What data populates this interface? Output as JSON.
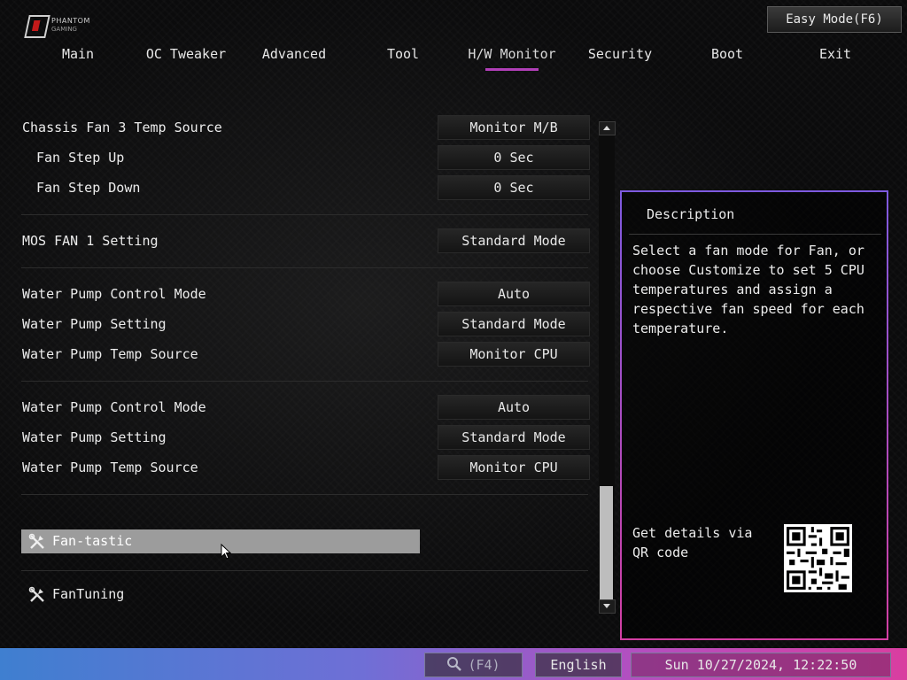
{
  "header": {
    "logo_line1": "PHANTOM",
    "logo_line2": "GAMING",
    "easy_mode": "Easy Mode(F6)"
  },
  "tabs": [
    {
      "label": "Main"
    },
    {
      "label": "OC Tweaker"
    },
    {
      "label": "Advanced"
    },
    {
      "label": "Tool"
    },
    {
      "label": "H/W Monitor",
      "active": true
    },
    {
      "label": "Security"
    },
    {
      "label": "Boot"
    },
    {
      "label": "Exit"
    }
  ],
  "settings": [
    {
      "label": "Chassis Fan 3 Temp Source",
      "value": "Monitor M/B"
    },
    {
      "label": "Fan Step Up",
      "value": "0 Sec"
    },
    {
      "label": "Fan Step Down",
      "value": "0 Sec"
    },
    {
      "label": "MOS FAN 1 Setting",
      "value": "Standard Mode"
    },
    {
      "label": "Water Pump Control Mode",
      "value": "Auto"
    },
    {
      "label": "Water Pump Setting",
      "value": "Standard Mode"
    },
    {
      "label": "Water Pump Temp Source",
      "value": "Monitor CPU"
    },
    {
      "label": "Water Pump Control Mode",
      "value": "Auto"
    },
    {
      "label": "Water Pump Setting",
      "value": "Standard Mode"
    },
    {
      "label": "Water Pump Temp Source",
      "value": "Monitor CPU"
    }
  ],
  "menu_items": [
    {
      "label": "Fan-tastic",
      "selected": true,
      "icon": "tools-icon"
    },
    {
      "label": "FanTuning",
      "selected": false,
      "icon": "tools-icon"
    }
  ],
  "description": {
    "title": "Description",
    "text": "Select a fan mode for Fan, or choose Customize to set 5 CPU temperatures and assign a respective fan speed for each temperature.",
    "qr_text": "Get details via QR code"
  },
  "footer": {
    "search": "(F4)",
    "language": "English",
    "clock": "Sun 10/27/2024, 12:22:50"
  },
  "colors": {
    "accent": "#b13fb8",
    "selection": "#9c9c9c",
    "footer_left": "#3f7fd0",
    "footer_right": "#d93ea0"
  }
}
